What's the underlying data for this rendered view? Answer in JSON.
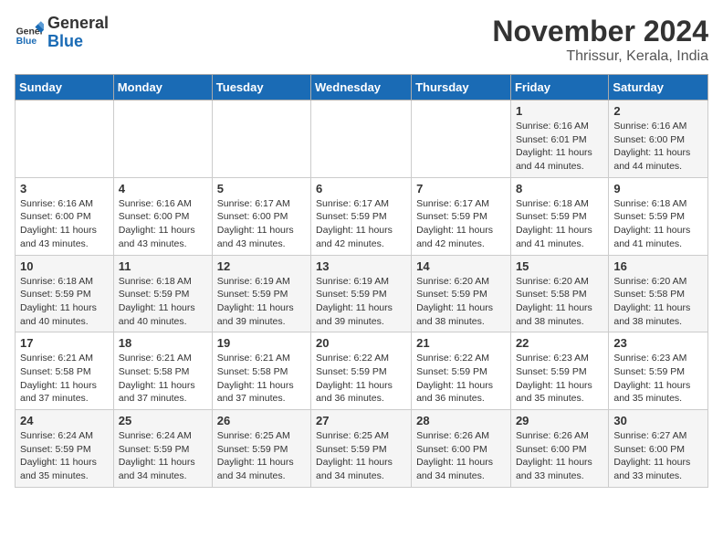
{
  "header": {
    "logo_general": "General",
    "logo_blue": "Blue",
    "month_title": "November 2024",
    "location": "Thrissur, Kerala, India"
  },
  "weekdays": [
    "Sunday",
    "Monday",
    "Tuesday",
    "Wednesday",
    "Thursday",
    "Friday",
    "Saturday"
  ],
  "weeks": [
    [
      {
        "day": "",
        "info": ""
      },
      {
        "day": "",
        "info": ""
      },
      {
        "day": "",
        "info": ""
      },
      {
        "day": "",
        "info": ""
      },
      {
        "day": "",
        "info": ""
      },
      {
        "day": "1",
        "info": "Sunrise: 6:16 AM\nSunset: 6:01 PM\nDaylight: 11 hours\nand 44 minutes."
      },
      {
        "day": "2",
        "info": "Sunrise: 6:16 AM\nSunset: 6:00 PM\nDaylight: 11 hours\nand 44 minutes."
      }
    ],
    [
      {
        "day": "3",
        "info": "Sunrise: 6:16 AM\nSunset: 6:00 PM\nDaylight: 11 hours\nand 43 minutes."
      },
      {
        "day": "4",
        "info": "Sunrise: 6:16 AM\nSunset: 6:00 PM\nDaylight: 11 hours\nand 43 minutes."
      },
      {
        "day": "5",
        "info": "Sunrise: 6:17 AM\nSunset: 6:00 PM\nDaylight: 11 hours\nand 43 minutes."
      },
      {
        "day": "6",
        "info": "Sunrise: 6:17 AM\nSunset: 5:59 PM\nDaylight: 11 hours\nand 42 minutes."
      },
      {
        "day": "7",
        "info": "Sunrise: 6:17 AM\nSunset: 5:59 PM\nDaylight: 11 hours\nand 42 minutes."
      },
      {
        "day": "8",
        "info": "Sunrise: 6:18 AM\nSunset: 5:59 PM\nDaylight: 11 hours\nand 41 minutes."
      },
      {
        "day": "9",
        "info": "Sunrise: 6:18 AM\nSunset: 5:59 PM\nDaylight: 11 hours\nand 41 minutes."
      }
    ],
    [
      {
        "day": "10",
        "info": "Sunrise: 6:18 AM\nSunset: 5:59 PM\nDaylight: 11 hours\nand 40 minutes."
      },
      {
        "day": "11",
        "info": "Sunrise: 6:18 AM\nSunset: 5:59 PM\nDaylight: 11 hours\nand 40 minutes."
      },
      {
        "day": "12",
        "info": "Sunrise: 6:19 AM\nSunset: 5:59 PM\nDaylight: 11 hours\nand 39 minutes."
      },
      {
        "day": "13",
        "info": "Sunrise: 6:19 AM\nSunset: 5:59 PM\nDaylight: 11 hours\nand 39 minutes."
      },
      {
        "day": "14",
        "info": "Sunrise: 6:20 AM\nSunset: 5:59 PM\nDaylight: 11 hours\nand 38 minutes."
      },
      {
        "day": "15",
        "info": "Sunrise: 6:20 AM\nSunset: 5:58 PM\nDaylight: 11 hours\nand 38 minutes."
      },
      {
        "day": "16",
        "info": "Sunrise: 6:20 AM\nSunset: 5:58 PM\nDaylight: 11 hours\nand 38 minutes."
      }
    ],
    [
      {
        "day": "17",
        "info": "Sunrise: 6:21 AM\nSunset: 5:58 PM\nDaylight: 11 hours\nand 37 minutes."
      },
      {
        "day": "18",
        "info": "Sunrise: 6:21 AM\nSunset: 5:58 PM\nDaylight: 11 hours\nand 37 minutes."
      },
      {
        "day": "19",
        "info": "Sunrise: 6:21 AM\nSunset: 5:58 PM\nDaylight: 11 hours\nand 37 minutes."
      },
      {
        "day": "20",
        "info": "Sunrise: 6:22 AM\nSunset: 5:59 PM\nDaylight: 11 hours\nand 36 minutes."
      },
      {
        "day": "21",
        "info": "Sunrise: 6:22 AM\nSunset: 5:59 PM\nDaylight: 11 hours\nand 36 minutes."
      },
      {
        "day": "22",
        "info": "Sunrise: 6:23 AM\nSunset: 5:59 PM\nDaylight: 11 hours\nand 35 minutes."
      },
      {
        "day": "23",
        "info": "Sunrise: 6:23 AM\nSunset: 5:59 PM\nDaylight: 11 hours\nand 35 minutes."
      }
    ],
    [
      {
        "day": "24",
        "info": "Sunrise: 6:24 AM\nSunset: 5:59 PM\nDaylight: 11 hours\nand 35 minutes."
      },
      {
        "day": "25",
        "info": "Sunrise: 6:24 AM\nSunset: 5:59 PM\nDaylight: 11 hours\nand 34 minutes."
      },
      {
        "day": "26",
        "info": "Sunrise: 6:25 AM\nSunset: 5:59 PM\nDaylight: 11 hours\nand 34 minutes."
      },
      {
        "day": "27",
        "info": "Sunrise: 6:25 AM\nSunset: 5:59 PM\nDaylight: 11 hours\nand 34 minutes."
      },
      {
        "day": "28",
        "info": "Sunrise: 6:26 AM\nSunset: 6:00 PM\nDaylight: 11 hours\nand 34 minutes."
      },
      {
        "day": "29",
        "info": "Sunrise: 6:26 AM\nSunset: 6:00 PM\nDaylight: 11 hours\nand 33 minutes."
      },
      {
        "day": "30",
        "info": "Sunrise: 6:27 AM\nSunset: 6:00 PM\nDaylight: 11 hours\nand 33 minutes."
      }
    ]
  ]
}
